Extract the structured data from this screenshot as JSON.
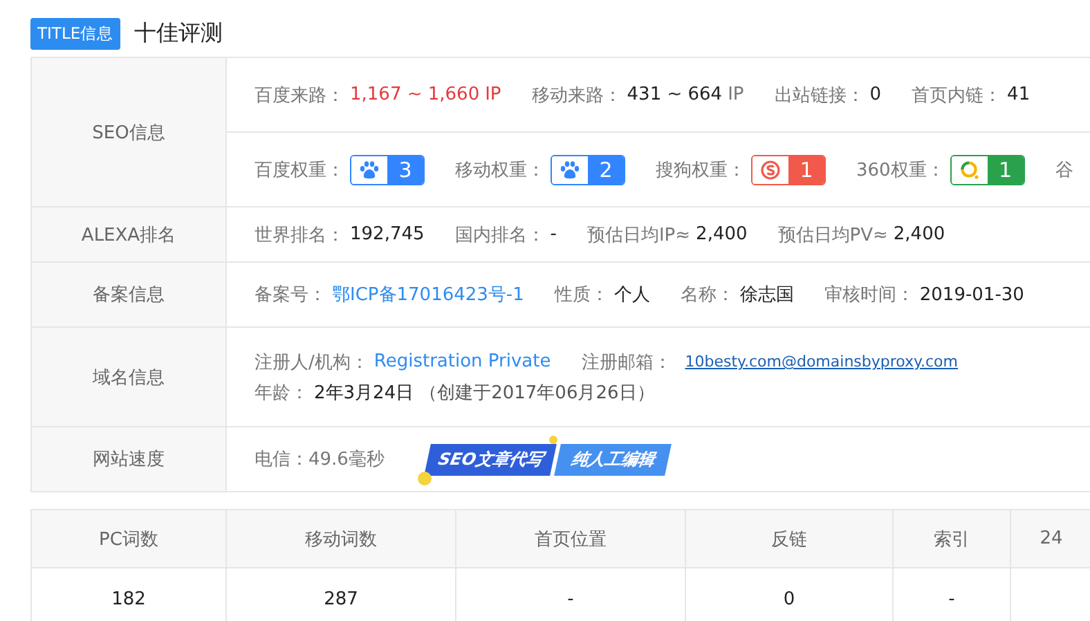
{
  "title": {
    "badge": "TITLE信息",
    "text": "十佳评测"
  },
  "info_rows": [
    {
      "label": "SEO信息",
      "lines": [
        [
          {
            "kind": "highlight",
            "label": "百度来路：",
            "value": "1,167 ~ 1,660",
            "unit": "IP"
          },
          {
            "kind": "stat",
            "label": "移动来路：",
            "value": "431 ~ 664",
            "unit": "IP"
          },
          {
            "kind": "stat",
            "label": "出站链接：",
            "value": "0"
          },
          {
            "kind": "stat",
            "label": "首页内链：",
            "value": "41"
          }
        ],
        [
          {
            "kind": "baidu_weight",
            "label": "百度权重：",
            "value": "3"
          },
          {
            "kind": "mobile_weight",
            "label": "移动权重：",
            "value": "2"
          },
          {
            "kind": "sogou_weight",
            "label": "搜狗权重：",
            "value": "1"
          },
          {
            "kind": "so360_weight",
            "label": "360权重：",
            "value": "1"
          },
          {
            "kind": "label",
            "label": "谷"
          }
        ]
      ]
    },
    {
      "label": "ALEXA排名",
      "lines": [
        [
          {
            "kind": "stat",
            "label": "世界排名：",
            "value": "192,745"
          },
          {
            "kind": "stat",
            "label": "国内排名：",
            "value": "-"
          },
          {
            "kind": "stat",
            "label": "预估日均IP≈",
            "value": "2,400"
          },
          {
            "kind": "stat",
            "label": "预估日均PV≈",
            "value": "2,400"
          }
        ]
      ]
    },
    {
      "label": "备案信息",
      "lines": [
        [
          {
            "kind": "link",
            "label": "备案号：",
            "value": "鄂ICP备17016423号-1"
          },
          {
            "kind": "stat",
            "label": "性质：",
            "value": "个人"
          },
          {
            "kind": "stat",
            "label": "名称：",
            "value": "徐志国"
          },
          {
            "kind": "stat",
            "label": "审核时间：",
            "value": "2019-01-30"
          }
        ]
      ]
    },
    {
      "label": "域名信息",
      "lines": [
        [
          {
            "kind": "link",
            "label": "注册人/机构：",
            "value": "Registration Private"
          },
          {
            "kind": "email",
            "label": "注册邮箱：",
            "value": "10besty.com@domainsbyproxy.com"
          }
        ],
        [
          {
            "kind": "stat",
            "label": "年龄：",
            "value": "2年3月24日",
            "note": "（创建于2017年06月26日）"
          }
        ]
      ]
    },
    {
      "label": "网站速度",
      "lines": [
        [
          {
            "kind": "label",
            "label": "电信：49.6毫秒"
          },
          {
            "kind": "ad",
            "texts": [
              "SEO文章代写",
              "纯人工编辑"
            ]
          }
        ]
      ]
    }
  ],
  "keywords": {
    "columns": [
      "PC词数",
      "移动词数",
      "首页位置",
      "反链",
      "索引",
      "24"
    ],
    "rows": [
      [
        "182",
        "287",
        "-",
        "0",
        "-",
        ""
      ]
    ]
  }
}
